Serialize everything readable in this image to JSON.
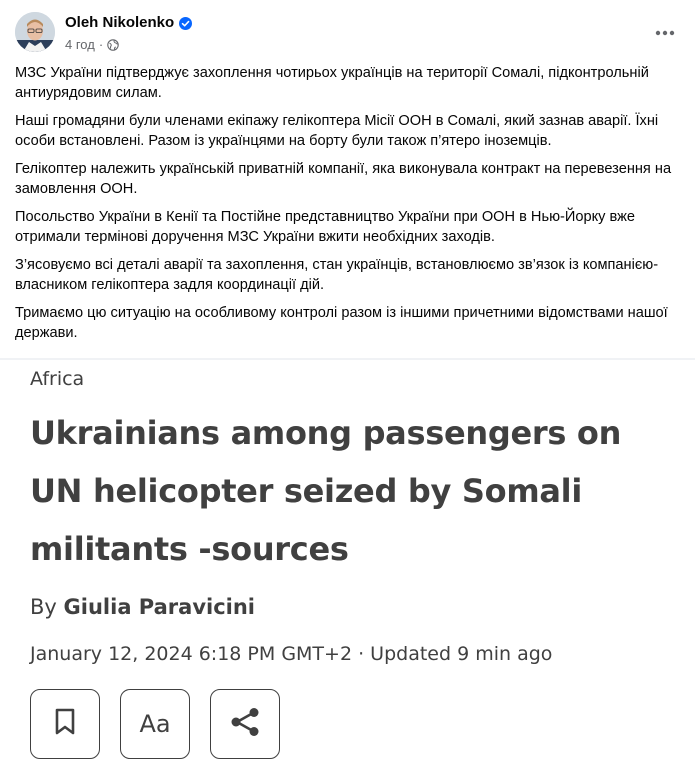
{
  "post": {
    "author": "Oleh Nikolenko",
    "verified": true,
    "time": "4 год",
    "audience_icon": "globe-icon",
    "more_icon": "more-horizontal-icon",
    "paragraphs": [
      "МЗС України підтверджує захоплення чотирьох українців на території Сомалі, підконтрольній антиурядовим силам.",
      "Наші громадяни були членами екіпажу гелікоптера Місії ООН в Сомалі, який зазнав аварії. Їхні особи встановлені. Разом із українцями на борту були також п’ятеро іноземців.",
      "Гелікоптер належить українській приватній компанії, яка виконувала контракт на перевезення на замовлення ООН.",
      "Посольство України в Кенії та Постійне представництво України при ООН в Нью-Йорку вже отримали термінові доручення МЗС України вжити необхідних заходів.",
      "З’ясовуємо всі деталі аварії та захоплення, стан українців, встановлюємо зв’язок із компанією-власником гелікоптера задля координації дій.",
      "Тримаємо цю ситуацію на особливому контролі разом із іншими причетними відомствами нашої держави."
    ]
  },
  "article": {
    "section": "Africa",
    "headline_lines": [
      "Ukrainians among passengers on",
      "UN helicopter seized by Somali",
      "militants -sources"
    ],
    "byline_prefix": "By",
    "byline_author": "Giulia Paravicini",
    "dateline": "January 12, 2024 6:18 PM GMT+2 · Updated 9 min ago",
    "actions": {
      "bookmark_icon": "bookmark-icon",
      "text_size_label": "Aa",
      "share_icon": "share-icon"
    }
  },
  "colors": {
    "verified_blue": "#0866ff",
    "article_text": "#404040",
    "meta_gray": "#65676b"
  }
}
